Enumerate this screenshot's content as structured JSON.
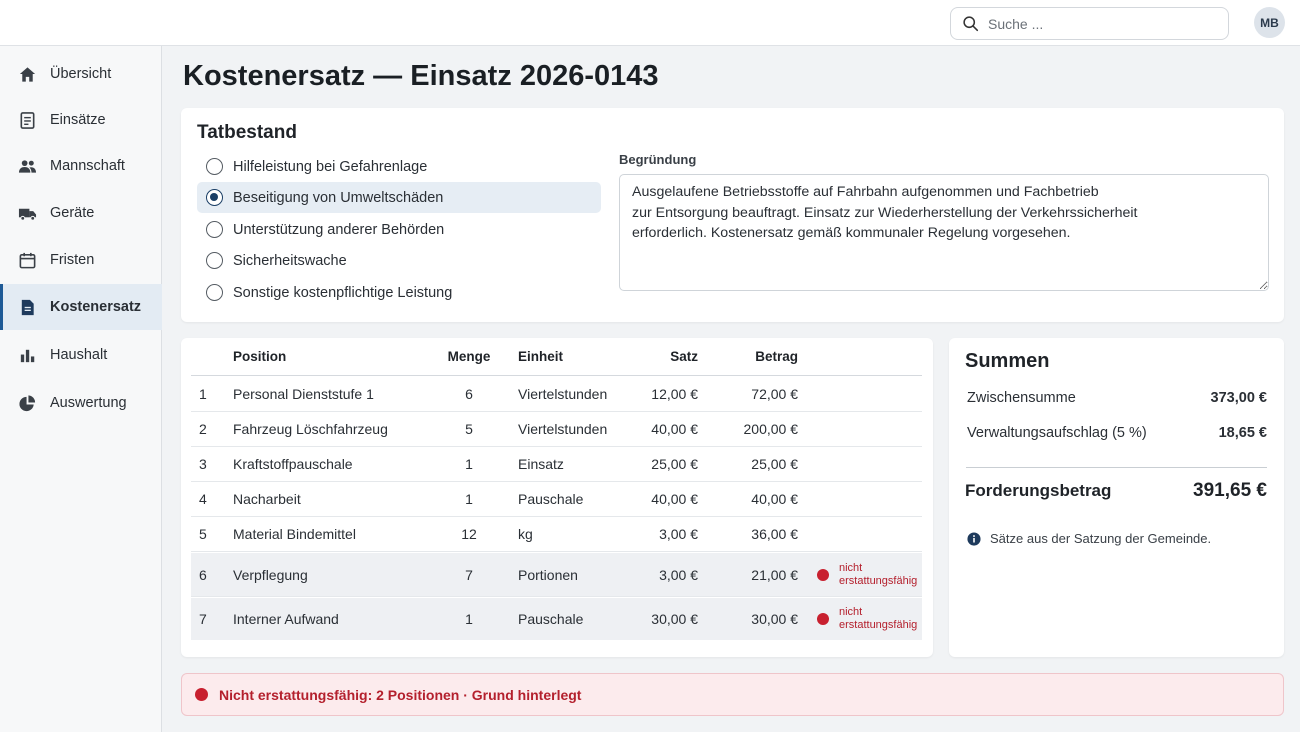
{
  "header": {
    "search_placeholder": "Suche ...",
    "user_initials": "MB"
  },
  "sidebar": {
    "items": [
      {
        "label": "Übersicht",
        "icon": "home-icon"
      },
      {
        "label": "Einsätze",
        "icon": "document-icon"
      },
      {
        "label": "Mannschaft",
        "icon": "people-icon"
      },
      {
        "label": "Geräte",
        "icon": "truck-icon"
      },
      {
        "label": "Fristen",
        "icon": "calendar-icon"
      },
      {
        "label": "Kostenersatz",
        "icon": "invoice-icon",
        "active": true
      },
      {
        "label": "Haushalt",
        "icon": "bar-chart-icon"
      },
      {
        "label": "Auswertung",
        "icon": "pie-chart-icon"
      }
    ]
  },
  "page": {
    "title": "Kostenersatz — Einsatz 2026-0143"
  },
  "tatbestand": {
    "title": "Tatbestand",
    "options": [
      "Hilfeleistung bei Gefahrenlage",
      "Beseitigung von Umweltschäden",
      "Unterstützung anderer Behörden",
      "Sicherheitswache",
      "Sonstige kostenpflichtige Leistung"
    ],
    "selected": "Beseitigung von Umweltschäden",
    "begruendung_label": "Begründung",
    "begruendung_text": "Ausgelaufene Betriebsstoffe auf Fahrbahn aufgenommen und Fachbetrieb\nzur Entsorgung beauftragt. Einsatz zur Wiederherstellung der Verkehrssicherheit\nerforderlich. Kostenersatz gemäß kommunaler Regelung vorgesehen."
  },
  "table": {
    "headers": {
      "position": "Position",
      "menge": "Menge",
      "einheit": "Einheit",
      "satz": "Satz",
      "betrag": "Betrag"
    },
    "rows": [
      {
        "nr": "1",
        "position": "Personal Dienststufe 1",
        "menge": "6",
        "einheit": "Viertelstunden",
        "satz": "12,00 €",
        "betrag": "72,00 €",
        "flag": ""
      },
      {
        "nr": "2",
        "position": "Fahrzeug Löschfahrzeug",
        "menge": "5",
        "einheit": "Viertelstunden",
        "satz": "40,00 €",
        "betrag": "200,00 €",
        "flag": ""
      },
      {
        "nr": "3",
        "position": "Kraftstoffpauschale",
        "menge": "1",
        "einheit": "Einsatz",
        "satz": "25,00 €",
        "betrag": "25,00 €",
        "flag": ""
      },
      {
        "nr": "4",
        "position": "Nacharbeit",
        "menge": "1",
        "einheit": "Pauschale",
        "satz": "40,00 €",
        "betrag": "40,00 €",
        "flag": ""
      },
      {
        "nr": "5",
        "position": "Material Bindemittel",
        "menge": "12",
        "einheit": "kg",
        "satz": "3,00 €",
        "betrag": "36,00 €",
        "flag": ""
      },
      {
        "nr": "6",
        "position": "Verpflegung",
        "menge": "7",
        "einheit": "Portionen",
        "satz": "3,00 €",
        "betrag": "21,00 €",
        "flag": "nicht erstattungsfähig"
      },
      {
        "nr": "7",
        "position": "Interner Aufwand",
        "menge": "1",
        "einheit": "Pauschale",
        "satz": "30,00 €",
        "betrag": "30,00 €",
        "flag": "nicht erstattungsfähig"
      }
    ]
  },
  "summen": {
    "title": "Summen",
    "zwischensumme_label": "Zwischensumme",
    "zwischensumme_value": "373,00 €",
    "aufschlag_label": "Verwaltungsaufschlag (5 %)",
    "aufschlag_value": "18,65 €",
    "forderung_label": "Forderungsbetrag",
    "forderung_value": "391,65 €",
    "note": "Sätze aus der Satzung der Gemeinde."
  },
  "alert": {
    "text": "Nicht erstattungsfähig: 2 Positionen · Grund hinterlegt"
  },
  "colors": {
    "accent": "#1e5a96",
    "danger": "#c8202f",
    "alert_bg": "#fcebed"
  }
}
